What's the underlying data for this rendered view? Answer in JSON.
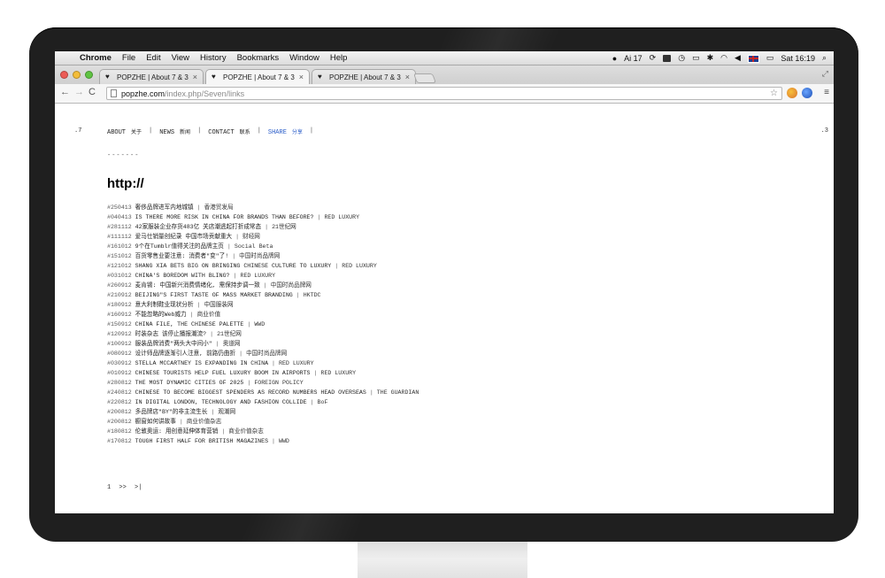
{
  "menubar": {
    "apple_icon": "apple-icon",
    "items": [
      "Chrome",
      "File",
      "Edit",
      "View",
      "History",
      "Bookmarks",
      "Window",
      "Help"
    ],
    "adobe_count": "17",
    "clock": "Sat 16:19"
  },
  "tabs": [
    {
      "label": "POPZHE | About 7 & 3"
    },
    {
      "label": "POPZHE | About 7 & 3"
    },
    {
      "label": "POPZHE | About 7 & 3"
    }
  ],
  "toolbar": {
    "url_host": "popzhe.com",
    "url_path": "/index.php/Seven/links"
  },
  "page": {
    "corner_left": ".7",
    "corner_right": ".3",
    "nav": [
      {
        "en": "ABOUT",
        "cn": "关于"
      },
      {
        "en": "NEWS",
        "cn": "新闻"
      },
      {
        "en": "CONTACT",
        "cn": "联系"
      },
      {
        "en": "SHARE",
        "cn": "分享"
      }
    ],
    "nav_separator": "|",
    "dashes": "-------",
    "heading": "http://",
    "links": [
      {
        "id": "#250413",
        "title": "奢侈品牌进军内地城镇",
        "source": "香港贸发局"
      },
      {
        "id": "#040413",
        "title": "IS THERE MORE RISK IN CHINA FOR BRANDS THAN BEFORE?",
        "source": "RED LUXURY"
      },
      {
        "id": "#281112",
        "title": "42家服装企业存货483亿 关店潮逃起打折成常态",
        "source": "21世纪网"
      },
      {
        "id": "#111112",
        "title": "爱马仕销量创纪录 中国市场贡献重大",
        "source": "财经网"
      },
      {
        "id": "#161012",
        "title": "9个在Tumblr值得关注的品牌主页",
        "source": "Social Beta"
      },
      {
        "id": "#151012",
        "title": "百货零售业要注意: 消费者\"变\"了!",
        "source": "中国时尚品牌网"
      },
      {
        "id": "#121012",
        "title": "SHANG XIA BETS BIG ON BRINGING CHINESE CULTURE TO LUXURY",
        "source": "RED LUXURY"
      },
      {
        "id": "#031012",
        "title": "CHINA'S BOREDOM WITH BLING?",
        "source": "RED LUXURY"
      },
      {
        "id": "#260912",
        "title": "麦肯锡: 中国新兴消费情绪化, 需保持步调一致",
        "source": "中国时尚品牌网"
      },
      {
        "id": "#210912",
        "title": "BEIJING\"S FIRST TASTE OF MASS MARKET BRANDING",
        "source": "HKTDC"
      },
      {
        "id": "#180912",
        "title": "意大利制鞋业现状分析",
        "source": "中国服装网"
      },
      {
        "id": "#160912",
        "title": "不能忽略的Web威力",
        "source": "商业价值"
      },
      {
        "id": "#150912",
        "title": "CHINA FILE, THE CHINESE PALETTE",
        "source": "WWD"
      },
      {
        "id": "#120912",
        "title": "时装杂志 该停止播报潮流?",
        "source": "21世纪网"
      },
      {
        "id": "#100912",
        "title": "服装品牌消费\"两头大中间小\"",
        "source": "奥道网"
      },
      {
        "id": "#080912",
        "title": "设计师品牌逐渐引人注意, 前路仍曲折",
        "source": "中国时尚品牌网"
      },
      {
        "id": "#030912",
        "title": "STELLA MCCARTNEY IS EXPANDING IN CHINA",
        "source": "RED LUXURY"
      },
      {
        "id": "#010912",
        "title": "CHINESE TOURISTS HELP FUEL LUXURY BOOM IN AIRPORTS",
        "source": "RED LUXURY"
      },
      {
        "id": "#280812",
        "title": "THE MOST DYNAMIC CITIES OF 2025",
        "source": "FOREIGN POLICY"
      },
      {
        "id": "#240812",
        "title": "CHINESE TO BECOME BIGGEST SPENDERS AS RECORD NUMBERS HEAD OVERSEAS",
        "source": "THE GUARDIAN"
      },
      {
        "id": "#220812",
        "title": "IN DIGITAL LONDON, TECHNOLOGY AND FASHION COLLIDE",
        "source": "BoF"
      },
      {
        "id": "#200812",
        "title": "多品牌店\"BY\"的非主流生长",
        "source": "观潮网"
      },
      {
        "id": "#200812",
        "title": "橱窗如何讲故事",
        "source": "商业价值杂志"
      },
      {
        "id": "#180812",
        "title": "伦敦奥运: 用创意延伸体育营销",
        "source": "商业价值杂志"
      },
      {
        "id": "#170812",
        "title": "TOUGH FIRST HALF FOR BRITISH MAGAZINES",
        "source": "WWD"
      }
    ],
    "link_separator": "|",
    "pager": [
      "1",
      ">>",
      ">|"
    ]
  },
  "colors": {
    "bezel": "#1f1f1f",
    "share_link": "#2a5dc9",
    "stand": "#e2e2e2"
  }
}
